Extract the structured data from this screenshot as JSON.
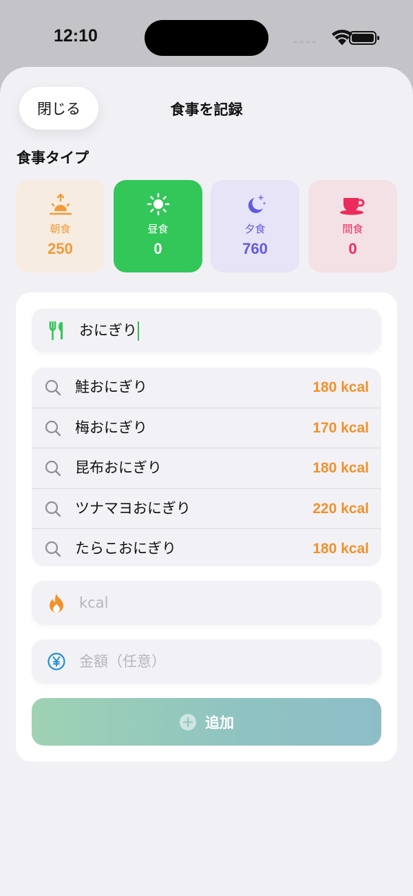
{
  "status_bar": {
    "time": "12:10"
  },
  "header": {
    "close_label": "閉じる",
    "title": "食事を記録"
  },
  "meal_type": {
    "section_label": "食事タイプ",
    "items": [
      {
        "name": "朝食",
        "value": "250",
        "icon": "sunrise-icon",
        "bg": "#f6ece2",
        "color": "#f39a37",
        "selected": false
      },
      {
        "name": "昼食",
        "value": "0",
        "icon": "sun-icon",
        "bg": "#33c659",
        "color": "#ffffff",
        "selected": true
      },
      {
        "name": "夕食",
        "value": "760",
        "icon": "moon-stars-icon",
        "bg": "#e6e4f6",
        "color": "#6359e0",
        "selected": false
      },
      {
        "name": "間食",
        "value": "0",
        "icon": "cup-icon",
        "bg": "#f3e1e6",
        "color": "#ec2c5c",
        "selected": false
      }
    ]
  },
  "food_input": {
    "value": "おにぎり",
    "icon": "fork-knife-icon"
  },
  "suggestions": [
    {
      "name": "鮭おにぎり",
      "kcal": "180 kcal"
    },
    {
      "name": "梅おにぎり",
      "kcal": "170 kcal"
    },
    {
      "name": "昆布おにぎり",
      "kcal": "180 kcal"
    },
    {
      "name": "ツナマヨおにぎり",
      "kcal": "220 kcal"
    },
    {
      "name": "たらこおにぎり",
      "kcal": "180 kcal"
    }
  ],
  "kcal_input": {
    "placeholder": "kcal",
    "icon": "flame-icon"
  },
  "price_input": {
    "placeholder": "金額（任意）",
    "icon": "yen-circle-icon"
  },
  "add_button": {
    "label": "追加",
    "icon": "plus-circle-icon"
  },
  "colors": {
    "accent_green": "#33c659",
    "kcal_orange": "#f3902a",
    "sheet_bg": "#f1f0f5"
  }
}
